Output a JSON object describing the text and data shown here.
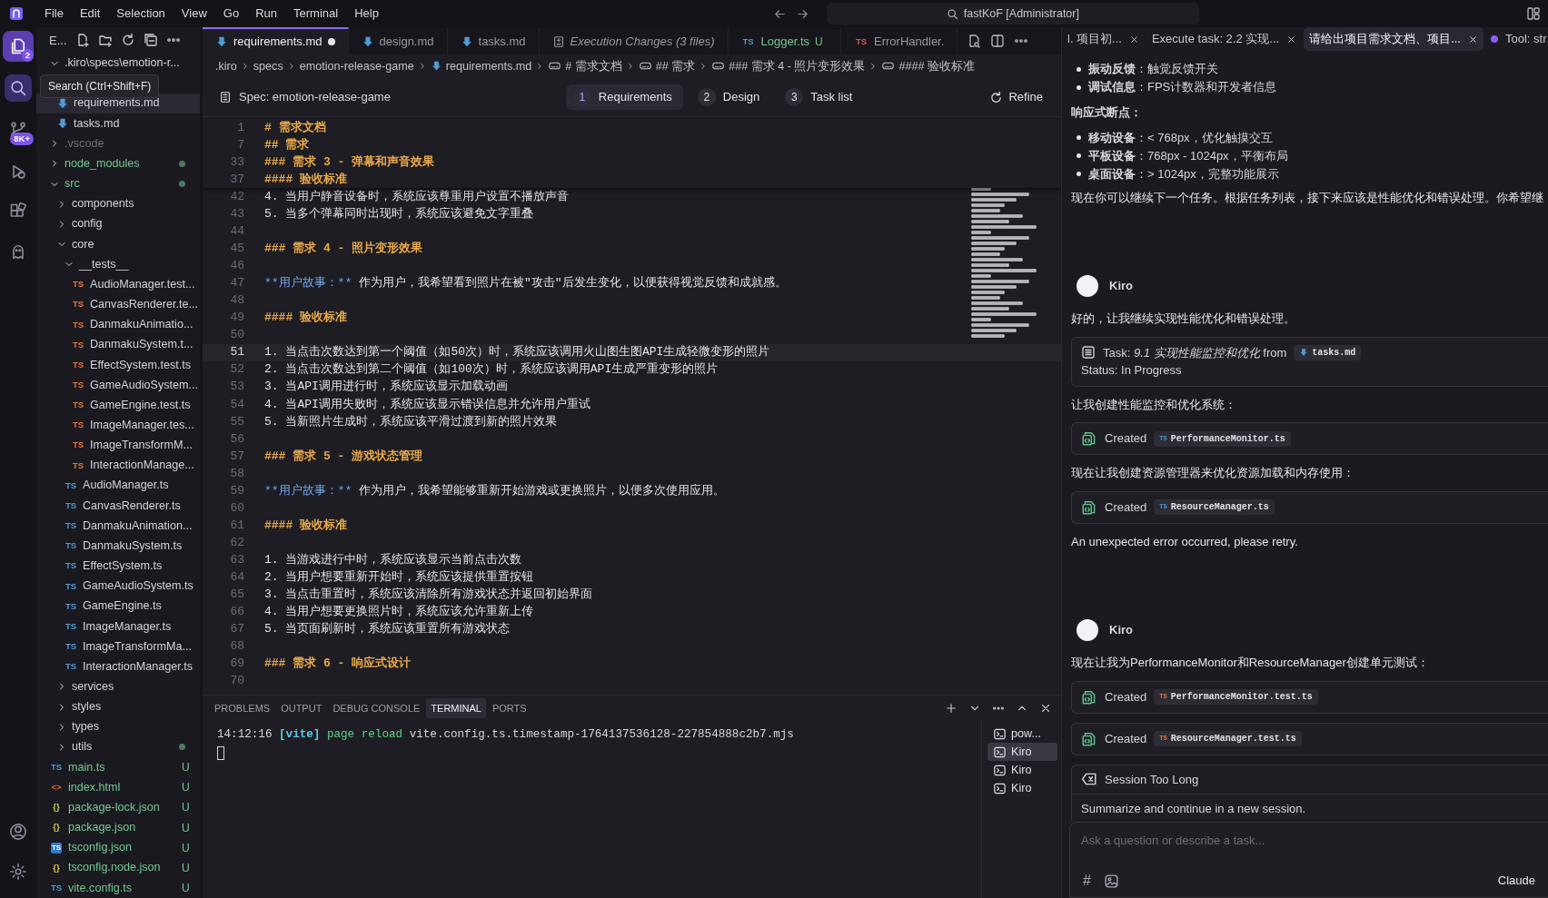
{
  "menu": [
    "File",
    "Edit",
    "Selection",
    "View",
    "Go",
    "Run",
    "Terminal",
    "Help"
  ],
  "command_center": "fastKoF [Administrator]",
  "activity_bar": {
    "top": [
      {
        "kind": "explorer",
        "selected": true,
        "hovered": false,
        "badge": "2"
      },
      {
        "kind": "search",
        "selected": false,
        "hovered": true
      },
      {
        "kind": "source-control",
        "selected": false,
        "hovered": false,
        "badge": "8K+"
      },
      {
        "kind": "debug",
        "selected": false,
        "hovered": false
      },
      {
        "kind": "extensions",
        "selected": false,
        "hovered": false
      },
      {
        "kind": "kiro",
        "selected": false,
        "hovered": false
      }
    ],
    "bottom": [
      {
        "kind": "account",
        "selected": false,
        "hovered": false
      },
      {
        "kind": "settings",
        "selected": false,
        "hovered": false
      }
    ]
  },
  "tooltip": "Search (Ctrl+Shift+F)",
  "sidebar": {
    "title": "E...",
    "tree": [
      {
        "label": ".kiro\\specs\\emotion-r...",
        "kind": "folder",
        "expanded": true,
        "selected": false,
        "children": [
          {
            "label": "requirements.md",
            "kind": "md",
            "selected": true
          },
          {
            "label": "tasks.md",
            "kind": "md",
            "selected": false
          }
        ]
      },
      {
        "label": ".vscode",
        "kind": "folder",
        "expanded": false,
        "selected": false,
        "ignored": true
      },
      {
        "label": "node_modules",
        "kind": "folder",
        "expanded": false,
        "selected": false,
        "untracked": true,
        "changes": true
      },
      {
        "label": "src",
        "kind": "folder",
        "expanded": true,
        "selected": false,
        "untracked": true,
        "changes": true,
        "children": [
          {
            "label": "components",
            "kind": "folder",
            "expanded": false,
            "selected": false
          },
          {
            "label": "config",
            "kind": "folder",
            "expanded": false,
            "selected": false
          },
          {
            "label": "core",
            "kind": "folder",
            "expanded": true,
            "selected": false,
            "children": [
              {
                "label": "__tests__",
                "kind": "folder",
                "expanded": true,
                "selected": false,
                "children": [
                  {
                    "label": "AudioManager.test...",
                    "kind": "test",
                    "icon_text": "TS",
                    "selected": false
                  },
                  {
                    "label": "CanvasRenderer.te...",
                    "kind": "test",
                    "icon_text": "TS",
                    "selected": false
                  },
                  {
                    "label": "DanmakuAnimatio...",
                    "kind": "test",
                    "icon_text": "TS",
                    "selected": false
                  },
                  {
                    "label": "DanmakuSystem.t...",
                    "kind": "test",
                    "icon_text": "TS",
                    "selected": false
                  },
                  {
                    "label": "EffectSystem.test.ts",
                    "kind": "test",
                    "icon_text": "TS",
                    "selected": false
                  },
                  {
                    "label": "GameAudioSystem...",
                    "kind": "test",
                    "icon_text": "TS",
                    "selected": false
                  },
                  {
                    "label": "GameEngine.test.ts",
                    "kind": "test",
                    "icon_text": "TS",
                    "selected": false
                  },
                  {
                    "label": "ImageManager.tes...",
                    "kind": "test",
                    "icon_text": "TS",
                    "selected": false
                  },
                  {
                    "label": "ImageTransformM...",
                    "kind": "test",
                    "icon_text": "TS",
                    "selected": false
                  },
                  {
                    "label": "InteractionManage...",
                    "kind": "test",
                    "icon_text": "TS",
                    "selected": false
                  }
                ]
              },
              {
                "label": "AudioManager.ts",
                "kind": "ts",
                "icon_text": "TS",
                "selected": false
              },
              {
                "label": "CanvasRenderer.ts",
                "kind": "ts",
                "icon_text": "TS",
                "selected": false
              },
              {
                "label": "DanmakuAnimation...",
                "kind": "ts",
                "icon_text": "TS",
                "selected": false
              },
              {
                "label": "DanmakuSystem.ts",
                "kind": "ts",
                "icon_text": "TS",
                "selected": false
              },
              {
                "label": "EffectSystem.ts",
                "kind": "ts",
                "icon_text": "TS",
                "selected": false
              },
              {
                "label": "GameAudioSystem.ts",
                "kind": "ts",
                "icon_text": "TS",
                "selected": false
              },
              {
                "label": "GameEngine.ts",
                "kind": "ts",
                "icon_text": "TS",
                "selected": false
              },
              {
                "label": "ImageManager.ts",
                "kind": "ts",
                "icon_text": "TS",
                "selected": false
              },
              {
                "label": "ImageTransformMa...",
                "kind": "ts",
                "icon_text": "TS",
                "selected": false
              },
              {
                "label": "InteractionManager.ts",
                "kind": "ts",
                "icon_text": "TS",
                "selected": false
              }
            ]
          },
          {
            "label": "services",
            "kind": "folder",
            "expanded": false,
            "selected": false
          },
          {
            "label": "styles",
            "kind": "folder",
            "expanded": false,
            "selected": false
          },
          {
            "label": "types",
            "kind": "folder",
            "expanded": false,
            "selected": false
          },
          {
            "label": "utils",
            "kind": "folder",
            "expanded": false,
            "selected": false,
            "changes": true
          }
        ]
      },
      {
        "label": "main.ts",
        "kind": "ts",
        "icon_text": "TS",
        "selected": false,
        "untracked": true,
        "status": "U"
      },
      {
        "label": "index.html",
        "kind": "html",
        "icon_text": "<>",
        "selected": false,
        "untracked": true,
        "status": "U"
      },
      {
        "label": "package-lock.json",
        "kind": "json",
        "icon_text": "{}",
        "selected": false,
        "untracked": true,
        "status": "U"
      },
      {
        "label": "package.json",
        "kind": "json",
        "icon_text": "{}",
        "selected": false,
        "untracked": true,
        "status": "U"
      },
      {
        "label": "tsconfig.json",
        "kind": "tsconfig",
        "icon_text": "TS",
        "selected": false,
        "untracked": true,
        "status": "U"
      },
      {
        "label": "tsconfig.node.json",
        "kind": "json",
        "icon_text": "{}",
        "selected": false,
        "untracked": true,
        "status": "U"
      },
      {
        "label": "vite.config.ts",
        "kind": "ts",
        "icon_text": "TS",
        "selected": false,
        "untracked": true,
        "status": "U"
      }
    ]
  },
  "editor": {
    "tabs": [
      {
        "label": "requirements.md",
        "kind": "md",
        "selected": true,
        "dirty": true
      },
      {
        "label": "design.md",
        "kind": "md",
        "selected": false,
        "dirty": false
      },
      {
        "label": "tasks.md",
        "kind": "md",
        "selected": false,
        "dirty": false
      },
      {
        "label": "Execution Changes (3 files)",
        "kind": "diff",
        "selected": false,
        "dirty": false
      },
      {
        "label": "Logger.ts",
        "kind": "ts",
        "icon_text": "TS",
        "selected": false,
        "dirty": false,
        "untracked": true,
        "status": "U"
      },
      {
        "label": "ErrorHandler.",
        "kind": "error",
        "icon_text": "TS",
        "selected": false,
        "dirty": false
      }
    ],
    "breadcrumbs": [
      {
        "label": ".kiro",
        "kind": "folder"
      },
      {
        "label": "specs",
        "kind": "folder"
      },
      {
        "label": "emotion-release-game",
        "kind": "folder"
      },
      {
        "label": "requirements.md",
        "kind": "file"
      },
      {
        "label": "# 需求文档",
        "kind": "heading"
      },
      {
        "label": "## 需求",
        "kind": "heading"
      },
      {
        "label": "### 需求 4 - 照片变形效果",
        "kind": "heading"
      },
      {
        "label": "#### 验收标准",
        "kind": "heading"
      }
    ],
    "spec": {
      "title": "Spec: emotion-release-game",
      "steps": [
        {
          "number": "1",
          "label": "Requirements",
          "selected": true
        },
        {
          "number": "2",
          "label": "Design",
          "selected": false
        },
        {
          "number": "3",
          "label": "Task list",
          "selected": false
        }
      ],
      "refine": "Refine"
    },
    "sticky_lines": [
      {
        "number": "1",
        "kind": "heading",
        "text": "# 需求文档"
      },
      {
        "number": "7",
        "kind": "heading",
        "text": "## 需求"
      },
      {
        "number": "33",
        "kind": "heading",
        "text": "### 需求 3 - 弹幕和声音效果"
      },
      {
        "number": "37",
        "kind": "heading",
        "text": "#### 验收标准"
      }
    ],
    "lines": [
      {
        "number": "42",
        "kind": "list",
        "text": "4. 当用户静音设备时，系统应该尊重用户设置不播放声音",
        "cursor": false
      },
      {
        "number": "43",
        "kind": "list",
        "text": "5. 当多个弹幕同时出现时，系统应该避免文字重叠",
        "cursor": false
      },
      {
        "number": "44",
        "kind": "blank",
        "cursor": false
      },
      {
        "number": "45",
        "kind": "heading",
        "text": "### 需求 4 - 照片变形效果",
        "cursor": false
      },
      {
        "number": "46",
        "kind": "blank",
        "cursor": false
      },
      {
        "number": "47",
        "kind": "story",
        "prefix": "**用户故事：**",
        "text": " 作为用户，我希望看到照片在被\"攻击\"后发生变化，以便获得视觉反馈和成就感。",
        "cursor": false
      },
      {
        "number": "48",
        "kind": "blank",
        "cursor": false
      },
      {
        "number": "49",
        "kind": "heading",
        "text": "#### 验收标准",
        "cursor": false
      },
      {
        "number": "50",
        "kind": "blank",
        "cursor": false
      },
      {
        "number": "51",
        "kind": "list",
        "text": "1. 当点击次数达到第一个阈值（如50次）时，系统应该调用火山图生图API生成轻微变形的照片",
        "cursor": true
      },
      {
        "number": "52",
        "kind": "list",
        "text": "2. 当点击次数达到第二个阈值（如100次）时，系统应该调用API生成严重变形的照片",
        "cursor": false
      },
      {
        "number": "53",
        "kind": "list",
        "text": "3. 当API调用进行时，系统应该显示加载动画",
        "cursor": false
      },
      {
        "number": "54",
        "kind": "list",
        "text": "4. 当API调用失败时，系统应该显示错误信息并允许用户重试",
        "cursor": false
      },
      {
        "number": "55",
        "kind": "list",
        "text": "5. 当新照片生成时，系统应该平滑过渡到新的照片效果",
        "cursor": false
      },
      {
        "number": "56",
        "kind": "blank",
        "cursor": false
      },
      {
        "number": "57",
        "kind": "heading",
        "text": "### 需求 5 - 游戏状态管理",
        "cursor": false
      },
      {
        "number": "58",
        "kind": "blank",
        "cursor": false
      },
      {
        "number": "59",
        "kind": "story",
        "prefix": "**用户故事：**",
        "text": " 作为用户，我希望能够重新开始游戏或更换照片，以便多次使用应用。",
        "cursor": false
      },
      {
        "number": "60",
        "kind": "blank",
        "cursor": false
      },
      {
        "number": "61",
        "kind": "heading",
        "text": "#### 验收标准",
        "cursor": false
      },
      {
        "number": "62",
        "kind": "blank",
        "cursor": false
      },
      {
        "number": "63",
        "kind": "list",
        "text": "1. 当游戏进行中时，系统应该显示当前点击次数",
        "cursor": false
      },
      {
        "number": "64",
        "kind": "list",
        "text": "2. 当用户想要重新开始时，系统应该提供重置按钮",
        "cursor": false
      },
      {
        "number": "65",
        "kind": "list",
        "text": "3. 当点击重置时，系统应该清除所有游戏状态并返回初始界面",
        "cursor": false
      },
      {
        "number": "66",
        "kind": "list",
        "text": "4. 当用户想要更换照片时，系统应该允许重新上传",
        "cursor": false
      },
      {
        "number": "67",
        "kind": "list",
        "text": "5. 当页面刷新时，系统应该重置所有游戏状态",
        "cursor": false
      },
      {
        "number": "68",
        "kind": "blank",
        "cursor": false
      },
      {
        "number": "69",
        "kind": "heading",
        "text": "### 需求 6 - 响应式设计",
        "cursor": false
      },
      {
        "number": "70",
        "kind": "blank",
        "cursor": false
      }
    ]
  },
  "panel": {
    "tabs": [
      {
        "label": "PROBLEMS",
        "selected": false
      },
      {
        "label": "OUTPUT",
        "selected": false
      },
      {
        "label": "DEBUG CONSOLE",
        "selected": false
      },
      {
        "label": "TERMINAL",
        "selected": true
      },
      {
        "label": "PORTS",
        "selected": false
      }
    ],
    "output": [
      {
        "kind": "plain",
        "text": "14:12:16 "
      },
      {
        "kind": "tag",
        "text": "[vite]"
      },
      {
        "kind": "success",
        "text": " page reload"
      },
      {
        "kind": "plain",
        "text": " vite.config.ts.timestamp-1764137536128-227854888c2b7.mjs"
      }
    ],
    "terminals": [
      {
        "label": "pow...",
        "selected": false
      },
      {
        "label": "Kiro",
        "selected": true
      },
      {
        "label": "Kiro",
        "selected": false
      },
      {
        "label": "Kiro",
        "selected": false
      }
    ]
  },
  "chat": {
    "tabs": [
      {
        "label": "l. 项目初...",
        "selected": false,
        "dot": false
      },
      {
        "label": "Execute task: 2.2 实现...",
        "selected": false,
        "dot": false
      },
      {
        "label": "请给出项目需求文档、项目...",
        "selected": true,
        "dot": false
      },
      {
        "label": "Tool: str",
        "selected": false,
        "dot": true
      }
    ],
    "items": [
      {
        "kind": "bullet",
        "text": "**振动反馈**：触觉反馈开关"
      },
      {
        "kind": "bullet",
        "text": "**调试信息**：FPS计数器和开发者信息"
      },
      {
        "kind": "heading",
        "text": "**响应式断点：**"
      },
      {
        "kind": "bullet",
        "text": "**移动设备**：< 768px，优化触摸交互"
      },
      {
        "kind": "bullet",
        "text": "**平板设备**：768px - 1024px，平衡布局"
      },
      {
        "kind": "bullet",
        "text": "**桌面设备**：> 1024px，完整功能展示"
      },
      {
        "kind": "paragraph",
        "text": "现在你可以继续下一个任务。根据任务列表，接下来应该是性能优化和错误处理。你希望继"
      },
      {
        "kind": "author",
        "name": "Kiro"
      },
      {
        "kind": "paragraph",
        "text": "好的，让我继续实现性能优化和错误处理。"
      },
      {
        "kind": "task",
        "title": "Task: *9.1 实现性能监控和优化* from",
        "file": {
          "name": "tasks.md",
          "kind": "md"
        },
        "status": "Status: In Progress"
      },
      {
        "kind": "paragraph",
        "text": "让我创建性能监控和优化系统："
      },
      {
        "kind": "created",
        "label": "Created",
        "file": {
          "name": "PerformanceMonitor.ts",
          "kind": "ts",
          "icon_text": "TS"
        }
      },
      {
        "kind": "paragraph",
        "text": "现在让我创建资源管理器来优化资源加载和内存使用："
      },
      {
        "kind": "created",
        "label": "Created",
        "file": {
          "name": "ResourceManager.ts",
          "kind": "ts",
          "icon_text": "TS"
        }
      },
      {
        "kind": "paragraph",
        "text": "An unexpected error occurred, please retry."
      },
      {
        "kind": "author",
        "name": "Kiro"
      },
      {
        "kind": "paragraph",
        "text": "现在让我为PerformanceMonitor和ResourceManager创建单元测试："
      },
      {
        "kind": "created",
        "label": "Created",
        "file": {
          "name": "PerformanceMonitor.test.ts",
          "kind": "test",
          "icon_text": "TS"
        }
      },
      {
        "kind": "created",
        "label": "Created",
        "file": {
          "name": "ResourceManager.test.ts",
          "kind": "test",
          "icon_text": "TS"
        }
      },
      {
        "kind": "notice",
        "title": "Session Too Long",
        "text": "Summarize and continue in a new session."
      }
    ],
    "input": {
      "placeholder": "Ask a question or describe a task...",
      "context_key": "#",
      "model": "Claude"
    }
  }
}
